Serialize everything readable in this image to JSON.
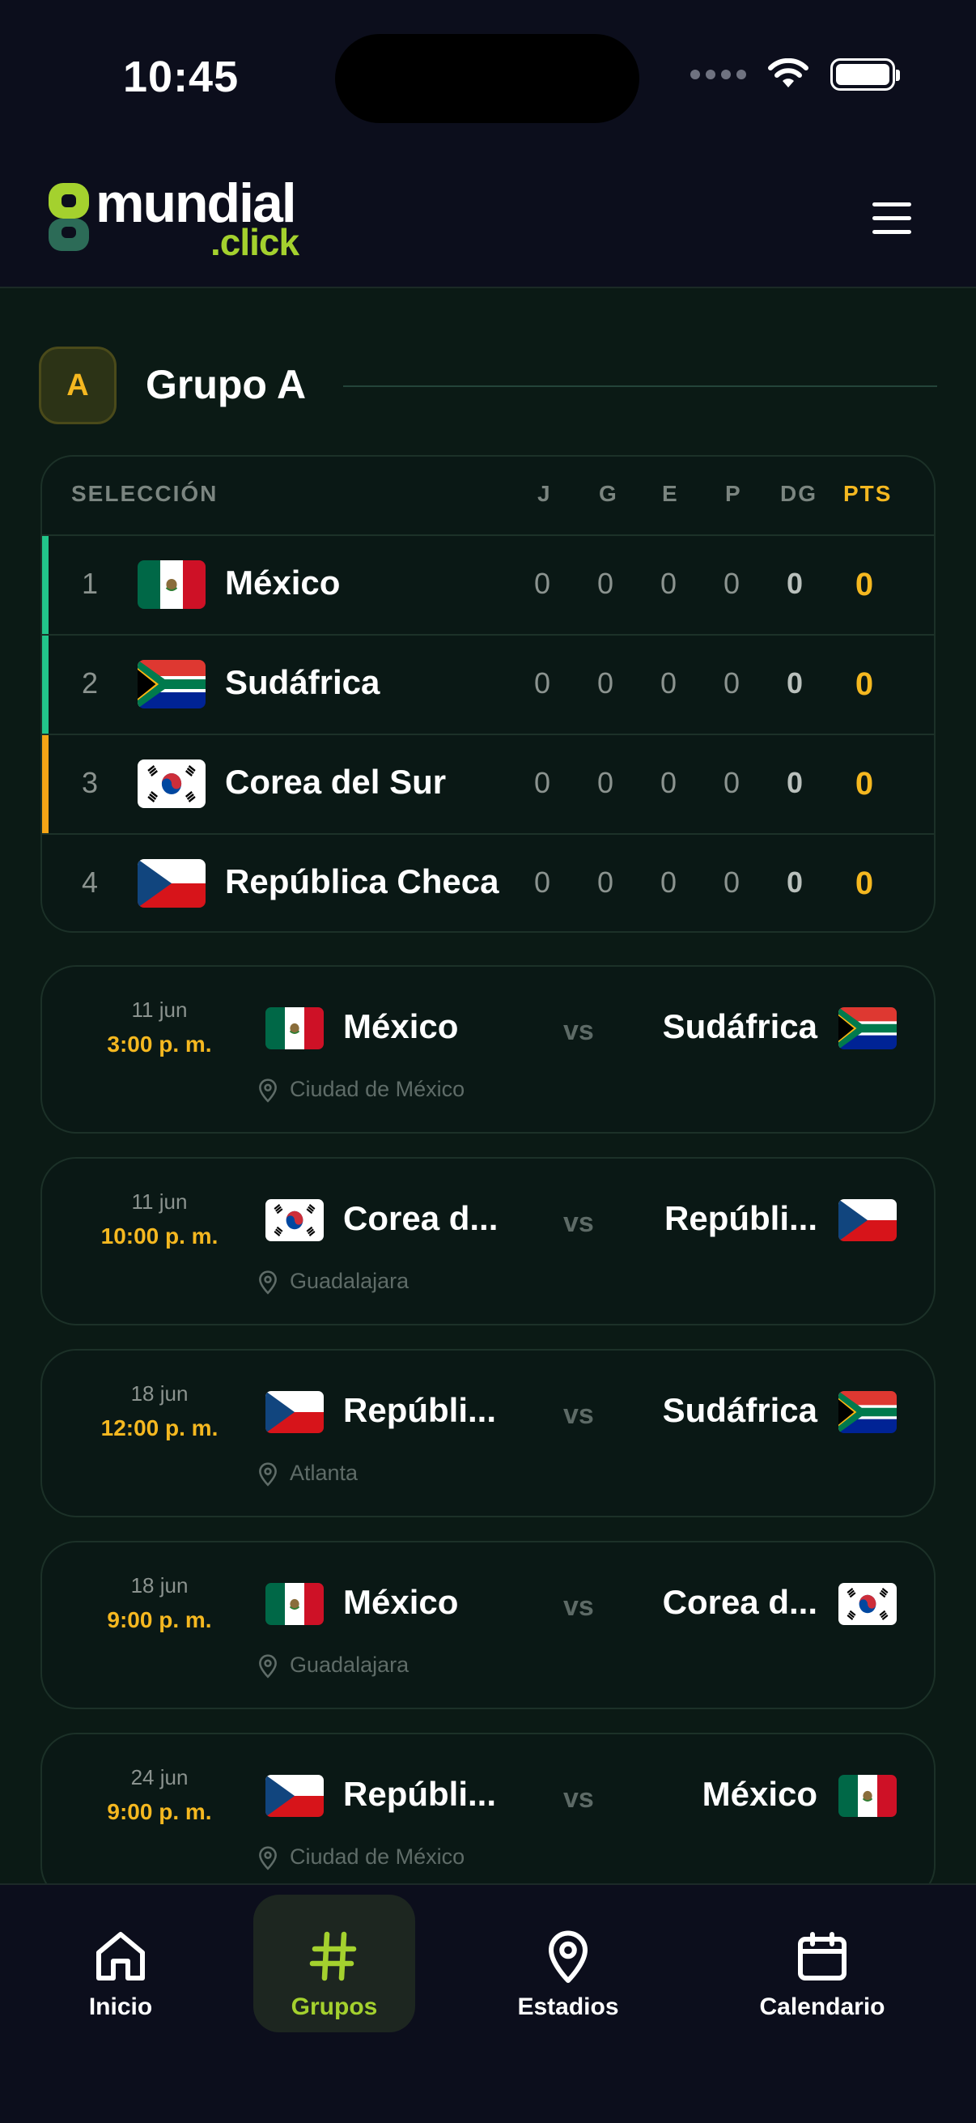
{
  "status_bar": {
    "time": "10:45"
  },
  "header": {
    "logo_main": "mundial",
    "logo_sub": ".click",
    "menu_icon": "hamburger-menu-icon"
  },
  "group": {
    "letter": "A",
    "title": "Grupo A"
  },
  "standings": {
    "columns": [
      "SELECCIÓN",
      "J",
      "G",
      "E",
      "P",
      "DG",
      "PTS"
    ],
    "rows": [
      {
        "pos": "1",
        "team": "México",
        "flag": "mexico",
        "indicator": "#22c58a",
        "j": "0",
        "g": "0",
        "e": "0",
        "p": "0",
        "dg": "0",
        "pts": "0"
      },
      {
        "pos": "2",
        "team": "Sudáfrica",
        "flag": "south-africa",
        "indicator": "#22c58a",
        "j": "0",
        "g": "0",
        "e": "0",
        "p": "0",
        "dg": "0",
        "pts": "0"
      },
      {
        "pos": "3",
        "team": "Corea del Sur",
        "flag": "south-korea",
        "indicator": "#f5a516",
        "j": "0",
        "g": "0",
        "e": "0",
        "p": "0",
        "dg": "0",
        "pts": "0"
      },
      {
        "pos": "4",
        "team": "República Checa",
        "flag": "czech-republic",
        "indicator": "",
        "j": "0",
        "g": "0",
        "e": "0",
        "p": "0",
        "dg": "0",
        "pts": "0"
      }
    ]
  },
  "matches": [
    {
      "date": "11 jun",
      "time": "3:00 p. m.",
      "home": "México",
      "home_flag": "mexico",
      "vs": "vs",
      "away": "Sudáfrica",
      "away_flag": "south-africa",
      "venue": "Ciudad de México"
    },
    {
      "date": "11 jun",
      "time": "10:00 p. m.",
      "home": "Corea d...",
      "home_flag": "south-korea",
      "vs": "vs",
      "away": "Repúbli...",
      "away_flag": "czech-republic",
      "venue": "Guadalajara"
    },
    {
      "date": "18 jun",
      "time": "12:00 p. m.",
      "home": "Repúbli...",
      "home_flag": "czech-republic",
      "vs": "vs",
      "away": "Sudáfrica",
      "away_flag": "south-africa",
      "venue": "Atlanta"
    },
    {
      "date": "18 jun",
      "time": "9:00 p. m.",
      "home": "México",
      "home_flag": "mexico",
      "vs": "vs",
      "away": "Corea d...",
      "away_flag": "south-korea",
      "venue": "Guadalajara"
    },
    {
      "date": "24 jun",
      "time": "9:00 p. m.",
      "home": "Repúbli...",
      "home_flag": "czech-republic",
      "vs": "vs",
      "away": "México",
      "away_flag": "mexico",
      "venue": "Ciudad de México"
    }
  ],
  "bottom_nav": [
    {
      "label": "Inicio",
      "icon": "home-icon",
      "active": false
    },
    {
      "label": "Grupos",
      "icon": "hash-icon",
      "active": true
    },
    {
      "label": "Estadios",
      "icon": "location-pin-icon",
      "active": false
    },
    {
      "label": "Calendario",
      "icon": "calendar-icon",
      "active": false
    }
  ],
  "colors": {
    "accent_green": "#a4d12e",
    "gold": "#f5b820",
    "background": "#0b1a15",
    "header_bg": "#0c0e1c"
  }
}
